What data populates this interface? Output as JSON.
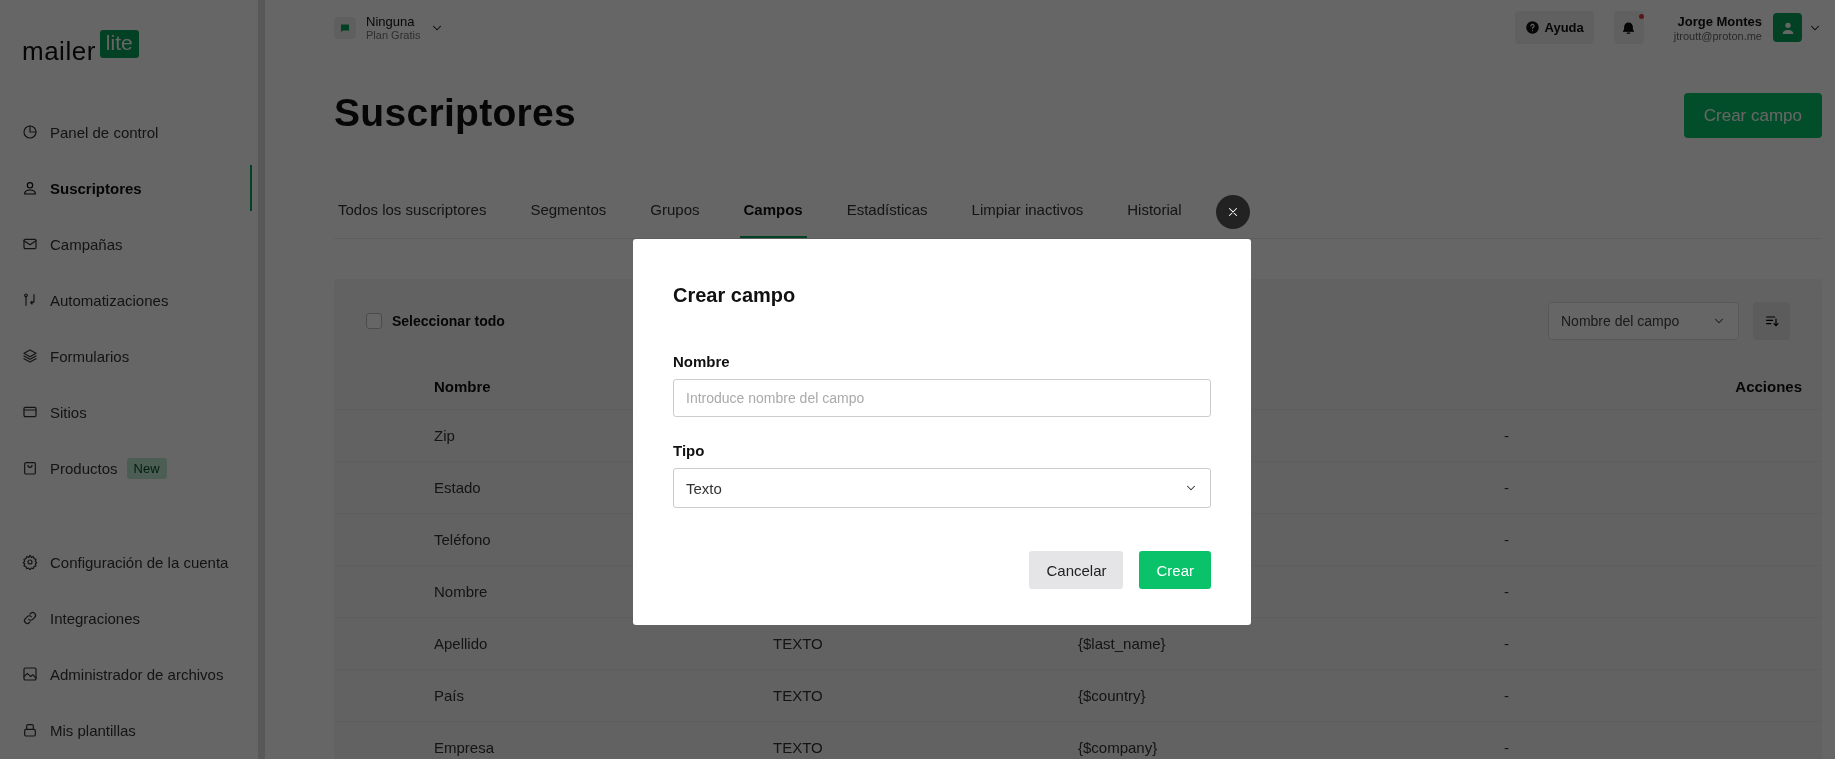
{
  "logo": {
    "text": "mailer",
    "badge": "lite"
  },
  "sidebar": {
    "items": [
      {
        "label": "Panel de control",
        "selected": false
      },
      {
        "label": "Suscriptores",
        "selected": true
      },
      {
        "label": "Campañas",
        "selected": false
      },
      {
        "label": "Automatizaciones",
        "selected": false
      },
      {
        "label": "Formularios",
        "selected": false
      },
      {
        "label": "Sitios",
        "selected": false
      },
      {
        "label": "Productos",
        "selected": false,
        "badge": "New"
      }
    ],
    "bottom_items": [
      {
        "label": "Configuración de la cuenta",
        "selected": false
      },
      {
        "label": "Integraciones",
        "selected": false
      },
      {
        "label": "Administrador de archivos",
        "selected": false
      },
      {
        "label": "Mis plantillas",
        "selected": false
      }
    ]
  },
  "topbar": {
    "workspace": {
      "name": "Ninguna",
      "plan": "Plan Gratis"
    },
    "help": "Ayuda",
    "notifications": {
      "unread": true
    },
    "user": {
      "name": "Jorge Montes",
      "email": "jtroutt@proton.me"
    }
  },
  "page": {
    "title": "Suscriptores",
    "action": "Crear campo"
  },
  "tabs": [
    {
      "label": "Todos los suscriptores",
      "selected": false
    },
    {
      "label": "Segmentos",
      "selected": false
    },
    {
      "label": "Grupos",
      "selected": false
    },
    {
      "label": "Campos",
      "selected": true
    },
    {
      "label": "Estadísticas",
      "selected": false
    },
    {
      "label": "Limpiar inactivos",
      "selected": false
    },
    {
      "label": "Historial",
      "selected": false
    }
  ],
  "table": {
    "select_all": {
      "label": "Seleccionar todo",
      "checked": false
    },
    "sort": {
      "value": "Nombre del campo"
    },
    "columns": [
      "Nombre",
      "Acciones"
    ],
    "rows": [
      {
        "name": "Zip",
        "actions": "-"
      },
      {
        "name": "Estado",
        "actions": "-"
      },
      {
        "name": "Teléfono",
        "actions": "-"
      },
      {
        "name": "Nombre",
        "actions": "-"
      },
      {
        "name": "Apellido",
        "type": "TEXTO",
        "tag": "{$last_name}",
        "actions": "-"
      },
      {
        "name": "País",
        "type": "TEXTO",
        "tag": "{$country}",
        "actions": "-"
      },
      {
        "name": "Empresa",
        "type": "TEXTO",
        "tag": "{$company}",
        "actions": "-"
      }
    ]
  },
  "modal": {
    "title": "Crear campo",
    "fields": [
      {
        "kind": "text",
        "label": "Nombre",
        "placeholder": "Introduce nombre del campo"
      },
      {
        "kind": "select",
        "label": "Tipo",
        "value": "Texto"
      }
    ],
    "buttons": [
      {
        "label": "Cancelar",
        "kind": "secondary"
      },
      {
        "label": "Crear",
        "kind": "primary"
      }
    ]
  }
}
